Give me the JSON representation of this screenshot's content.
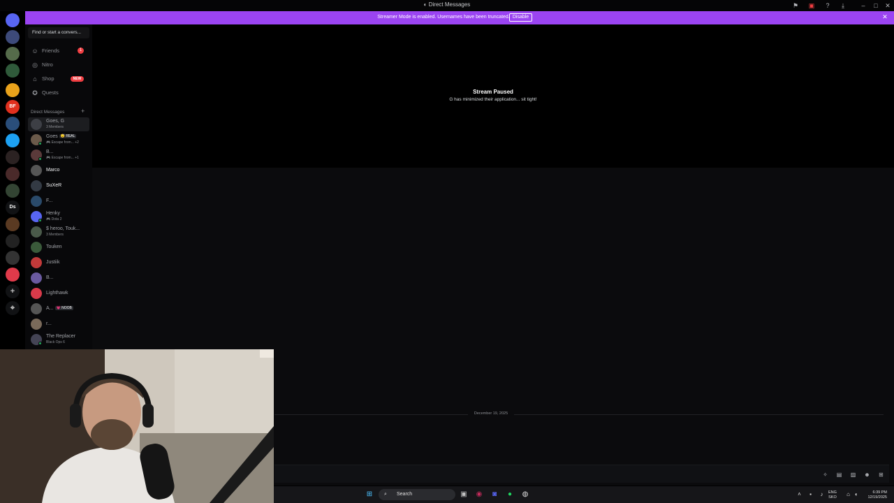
{
  "titlebar": {
    "title": "Direct Messages"
  },
  "banner": {
    "text": "Streamer Mode is enabled. Usernames have been truncated.",
    "button": "Disable",
    "color": "#9b44f2"
  },
  "rail": {
    "servers": [
      {
        "label": "",
        "color": "#5865f2",
        "icon": "discord-home-icon"
      },
      {
        "label": "",
        "color": "#3d4a7a"
      },
      {
        "label": "",
        "color": "#556b4a"
      },
      {
        "label": "",
        "color": "#2f5a3a"
      },
      {
        "label": "",
        "color": "#e9a21b"
      },
      {
        "label": "BF",
        "color": "#e0301e"
      },
      {
        "label": "",
        "color": "#2a4e7a"
      },
      {
        "label": "",
        "color": "#1da1f2"
      },
      {
        "label": "",
        "color": "#2b2222"
      },
      {
        "label": "",
        "color": "#4a2a2a"
      },
      {
        "label": "",
        "color": "#334433"
      },
      {
        "label": "Ds",
        "color": "#111214"
      },
      {
        "label": "",
        "color": "#5a3a22"
      },
      {
        "label": "",
        "color": "#222"
      },
      {
        "label": "",
        "color": "#333"
      },
      {
        "label": "",
        "color": "#e03a4a"
      }
    ]
  },
  "sidebar": {
    "search_placeholder": "Find or start a convers...",
    "nav": [
      {
        "label": "Friends",
        "icon": "friends-icon",
        "badge": "1"
      },
      {
        "label": "Nitro",
        "icon": "nitro-icon"
      },
      {
        "label": "Shop",
        "icon": "shop-icon",
        "tag": "NEW"
      },
      {
        "label": "Quests",
        "icon": "quests-icon"
      }
    ],
    "dm_header": "Direct Messages",
    "dms": [
      {
        "name": "Goes, G",
        "sub": "3 Members",
        "selected": true
      },
      {
        "name": "Goes",
        "tag": "😴 REAL",
        "sub": "🎮 Escape from... +2",
        "status": "#23a55a"
      },
      {
        "name": "B...",
        "sub": "🎮 Escape from... +1",
        "status": "#23a55a"
      },
      {
        "name": "Marco",
        "bright": true
      },
      {
        "name": "SuXeR",
        "bright": true
      },
      {
        "name": "F..."
      },
      {
        "name": "Henky",
        "sub": "🎮 Dota 2",
        "status": "#23a55a"
      },
      {
        "name": "$ heroo, Touk...",
        "sub": "3 Members"
      },
      {
        "name": "Touken"
      },
      {
        "name": "Justiik"
      },
      {
        "name": "B..."
      },
      {
        "name": "Lighthawk"
      },
      {
        "name": "A...",
        "tag": "💗 NOOB"
      },
      {
        "name": "r..."
      },
      {
        "name": "The Replacer",
        "sub": "Black Ops 6",
        "status": "#23a55a"
      }
    ]
  },
  "stream": {
    "title": "Stream Paused",
    "subtitle": "G has minimized their application... sit tight!"
  },
  "chat": {
    "date": "December 19, 2025"
  },
  "taskbar": {
    "search": "Search",
    "lang_1": "ENG",
    "lang_2": "SKO",
    "time": "6:39 PM",
    "date": "12/19/2025"
  }
}
